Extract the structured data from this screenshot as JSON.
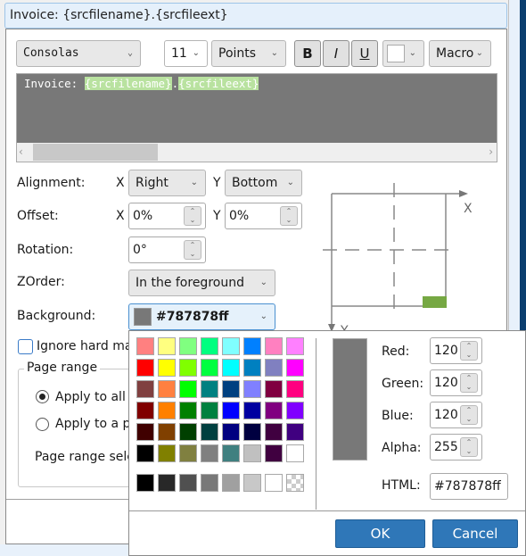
{
  "title": "Invoice: {srcfilename}.{srcfileext}",
  "toolbar": {
    "font": "Consolas",
    "size": "11",
    "unit": "Points",
    "bold": "B",
    "italic": "I",
    "underline": "U",
    "macro": "Macro",
    "text_color": "#ffffff"
  },
  "editor": {
    "prefix": "Invoice: ",
    "macro1": "{srcfilename}",
    "sep": ".",
    "macro2": "{srcfileext}",
    "background": "#787878",
    "macro_highlight": "#b9e2a0"
  },
  "form": {
    "alignment": {
      "label": "Alignment:",
      "x_label": "X",
      "x_value": "Right",
      "y_label": "Y",
      "y_value": "Bottom"
    },
    "offset": {
      "label": "Offset:",
      "x_label": "X",
      "x_value": "0%",
      "y_label": "Y",
      "y_value": "0%"
    },
    "rotation": {
      "label": "Rotation:",
      "value": "0°"
    },
    "zorder": {
      "label": "ZOrder:",
      "value": "In the foreground"
    },
    "background": {
      "label": "Background:",
      "value": "#787878ff",
      "swatch": "#787878"
    },
    "ignore_margins": {
      "label": "Ignore hard ma",
      "checked": false
    },
    "page_range": {
      "legend": "Page range",
      "apply_all": "Apply to all",
      "apply_partial": "Apply to a p",
      "selection_label": "Page range sele",
      "selected": "apply_all"
    }
  },
  "diagram": {
    "x_label": "X",
    "y_label": "Y",
    "position_color": "#76a843"
  },
  "color_picker": {
    "palette": [
      [
        "#ff8080",
        "#ffff80",
        "#80ff80",
        "#00ff80",
        "#80ffff",
        "#0080ff",
        "#ff80c0",
        "#ff80ff"
      ],
      [
        "#ff0000",
        "#ffff00",
        "#80ff00",
        "#00ff40",
        "#00ffff",
        "#0080c0",
        "#8080c0",
        "#ff00ff"
      ],
      [
        "#804040",
        "#ff8040",
        "#00ff00",
        "#008080",
        "#004080",
        "#8080ff",
        "#800040",
        "#ff0080"
      ],
      [
        "#800000",
        "#ff8000",
        "#008000",
        "#008040",
        "#0000ff",
        "#0000a0",
        "#800080",
        "#8000ff"
      ],
      [
        "#400000",
        "#804000",
        "#004000",
        "#004040",
        "#000080",
        "#000040",
        "#400040",
        "#400080"
      ],
      [
        "#000000",
        "#808000",
        "#808040",
        "#808080",
        "#408080",
        "#c0c0c0",
        "#400040",
        "#ffffff"
      ]
    ],
    "grays": [
      "#000000",
      "#282828",
      "#505050",
      "#787878",
      "#a0a0a0",
      "#c8c8c8",
      "#ffffff",
      "transparent"
    ],
    "preview": "#787878",
    "red_label": "Red:",
    "red": "120",
    "green_label": "Green:",
    "green": "120",
    "blue_label": "Blue:",
    "blue": "120",
    "alpha_label": "Alpha:",
    "alpha": "255",
    "html_label": "HTML:",
    "html": "#787878ff",
    "ok": "OK",
    "cancel": "Cancel"
  }
}
